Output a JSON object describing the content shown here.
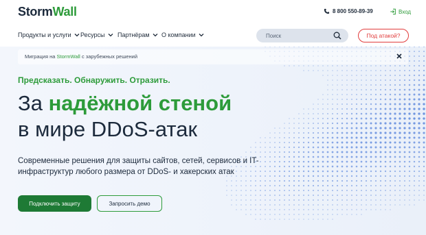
{
  "header": {
    "logo_part1": "Storm",
    "logo_part2": "Wall",
    "phone": "8 800 550-89-39",
    "login_label": "Вход"
  },
  "nav": {
    "items": [
      {
        "label": "Продукты и услуги"
      },
      {
        "label": "Ресурсы"
      },
      {
        "label": "Партнёрам"
      },
      {
        "label": "О компании"
      }
    ],
    "search_placeholder": "Поиск",
    "attack_button": "Под атакой?"
  },
  "banner": {
    "text_prefix": "Миграция на ",
    "text_highlight": "StormWall",
    "text_suffix": " с зарубежных решений"
  },
  "hero": {
    "tagline": "Предсказать. Обнаружить. Отразить.",
    "headline_line1_prefix": "За ",
    "headline_line1_accent": "надёжной стеной",
    "headline_line2": "в мире DDoS-атак",
    "subtext": "Современные решения для защиты сайтов, сетей, сервисов и IT-инфраструктур любого размера от DDoS- и хакерских атак",
    "primary_button": "Подключить защиту",
    "secondary_button": "Запросить демо"
  },
  "colors": {
    "brand_green": "#2d9b3a",
    "dark_green_button": "#1e7a35",
    "attack_red": "#e13c3c",
    "dot_blue": "#3b6fd6"
  },
  "icons": {
    "phone": "phone-icon",
    "login": "login-icon",
    "search": "search-icon",
    "close": "close-icon",
    "chevron": "chevron-down-icon"
  }
}
